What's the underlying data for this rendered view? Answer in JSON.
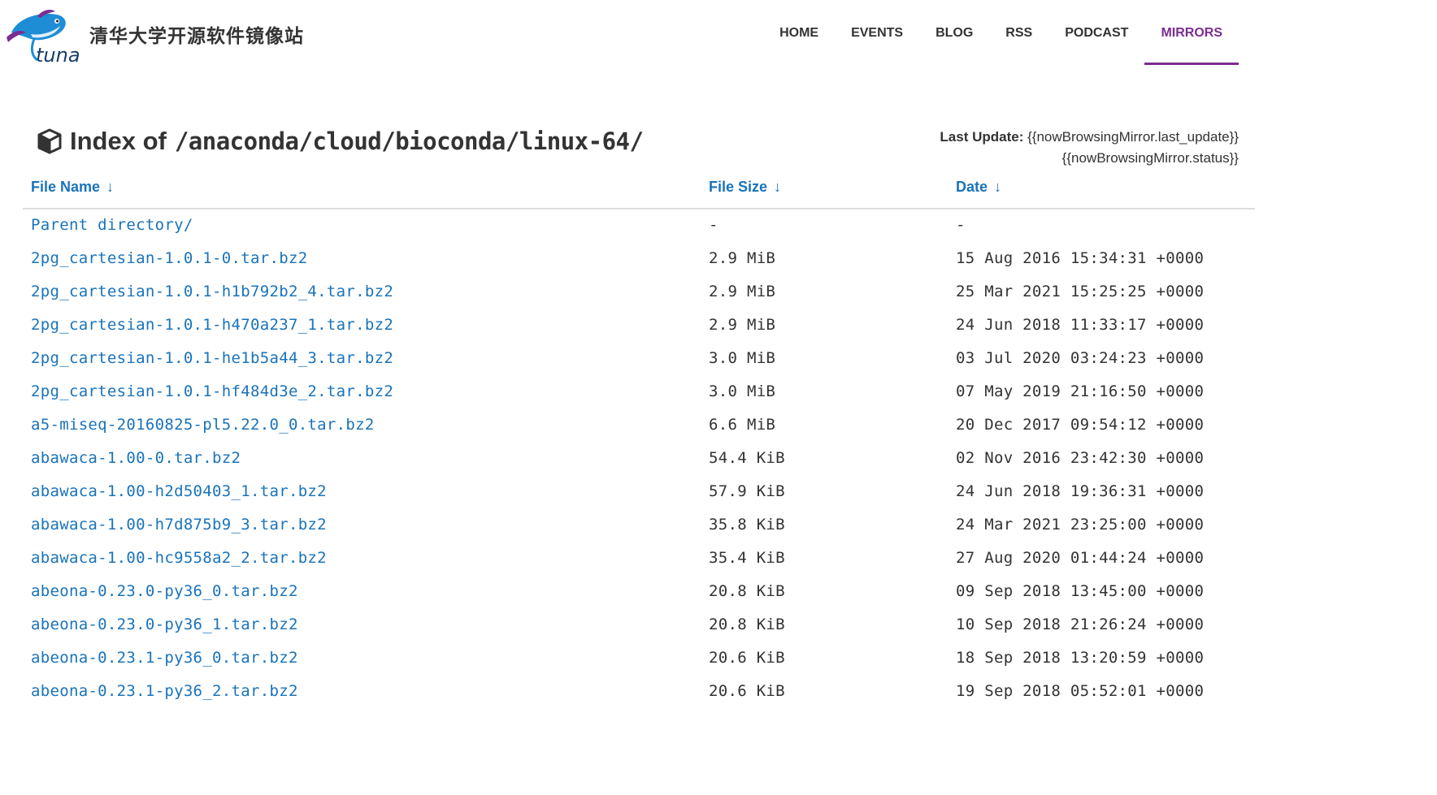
{
  "header": {
    "site_title": "清华大学开源软件镜像站",
    "logo_text": "tuna",
    "nav": [
      {
        "label": "HOME",
        "active": false
      },
      {
        "label": "EVENTS",
        "active": false
      },
      {
        "label": "BLOG",
        "active": false
      },
      {
        "label": "RSS",
        "active": false
      },
      {
        "label": "PODCAST",
        "active": false
      },
      {
        "label": "MIRRORS",
        "active": true
      }
    ]
  },
  "title": {
    "prefix": "Index of",
    "path": "/anaconda/cloud/bioconda/linux-64/",
    "icon": "cube-icon"
  },
  "update": {
    "label": "Last Update:",
    "value": "{{nowBrowsingMirror.last_update}}",
    "status": "{{nowBrowsingMirror.status}}"
  },
  "table": {
    "columns": {
      "name": "File Name",
      "size": "File Size",
      "date": "Date",
      "sort_arrow": "↓"
    },
    "rows": [
      {
        "name": "Parent directory/",
        "size": "-",
        "date": "-"
      },
      {
        "name": "2pg_cartesian-1.0.1-0.tar.bz2",
        "size": "2.9 MiB",
        "date": "15 Aug 2016 15:34:31 +0000"
      },
      {
        "name": "2pg_cartesian-1.0.1-h1b792b2_4.tar.bz2",
        "size": "2.9 MiB",
        "date": "25 Mar 2021 15:25:25 +0000"
      },
      {
        "name": "2pg_cartesian-1.0.1-h470a237_1.tar.bz2",
        "size": "2.9 MiB",
        "date": "24 Jun 2018 11:33:17 +0000"
      },
      {
        "name": "2pg_cartesian-1.0.1-he1b5a44_3.tar.bz2",
        "size": "3.0 MiB",
        "date": "03 Jul 2020 03:24:23 +0000"
      },
      {
        "name": "2pg_cartesian-1.0.1-hf484d3e_2.tar.bz2",
        "size": "3.0 MiB",
        "date": "07 May 2019 21:16:50 +0000"
      },
      {
        "name": "a5-miseq-20160825-pl5.22.0_0.tar.bz2",
        "size": "6.6 MiB",
        "date": "20 Dec 2017 09:54:12 +0000"
      },
      {
        "name": "abawaca-1.00-0.tar.bz2",
        "size": "54.4 KiB",
        "date": "02 Nov 2016 23:42:30 +0000"
      },
      {
        "name": "abawaca-1.00-h2d50403_1.tar.bz2",
        "size": "57.9 KiB",
        "date": "24 Jun 2018 19:36:31 +0000"
      },
      {
        "name": "abawaca-1.00-h7d875b9_3.tar.bz2",
        "size": "35.8 KiB",
        "date": "24 Mar 2021 23:25:00 +0000"
      },
      {
        "name": "abawaca-1.00-hc9558a2_2.tar.bz2",
        "size": "35.4 KiB",
        "date": "27 Aug 2020 01:44:24 +0000"
      },
      {
        "name": "abeona-0.23.0-py36_0.tar.bz2",
        "size": "20.8 KiB",
        "date": "09 Sep 2018 13:45:00 +0000"
      },
      {
        "name": "abeona-0.23.0-py36_1.tar.bz2",
        "size": "20.8 KiB",
        "date": "10 Sep 2018 21:26:24 +0000"
      },
      {
        "name": "abeona-0.23.1-py36_0.tar.bz2",
        "size": "20.6 KiB",
        "date": "18 Sep 2018 13:20:59 +0000"
      },
      {
        "name": "abeona-0.23.1-py36_2.tar.bz2",
        "size": "20.6 KiB",
        "date": "19 Sep 2018 05:52:01 +0000"
      }
    ]
  },
  "colors": {
    "accent": "#7b2d91",
    "link": "#1a73ba",
    "text": "#333333",
    "divider": "#dddddd"
  }
}
